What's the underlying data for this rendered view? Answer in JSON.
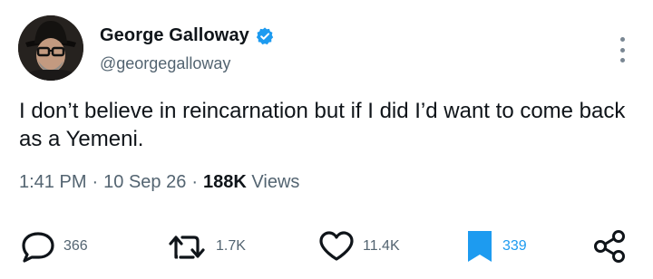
{
  "author": {
    "display_name": "George Galloway",
    "handle": "@georgegalloway",
    "verified": true
  },
  "tweet": {
    "text": "I don’t believe in reincarnation but if I did I’d want to come back as a Yemeni."
  },
  "meta": {
    "time": "1:41 PM",
    "separator": "·",
    "date": "10 Sep 26",
    "views_count": "188K",
    "views_label": "Views"
  },
  "actions": {
    "replies": "366",
    "reposts": "1.7K",
    "likes": "11.4K",
    "bookmarks": "339"
  },
  "colors": {
    "verified": "#1d9bf0",
    "bookmark_active": "#1d9bf0",
    "text_primary": "#0f1419",
    "text_secondary": "#536471"
  },
  "icons": [
    "verified-badge-icon",
    "more-icon",
    "reply-icon",
    "repost-icon",
    "like-icon",
    "bookmark-icon",
    "share-icon"
  ]
}
